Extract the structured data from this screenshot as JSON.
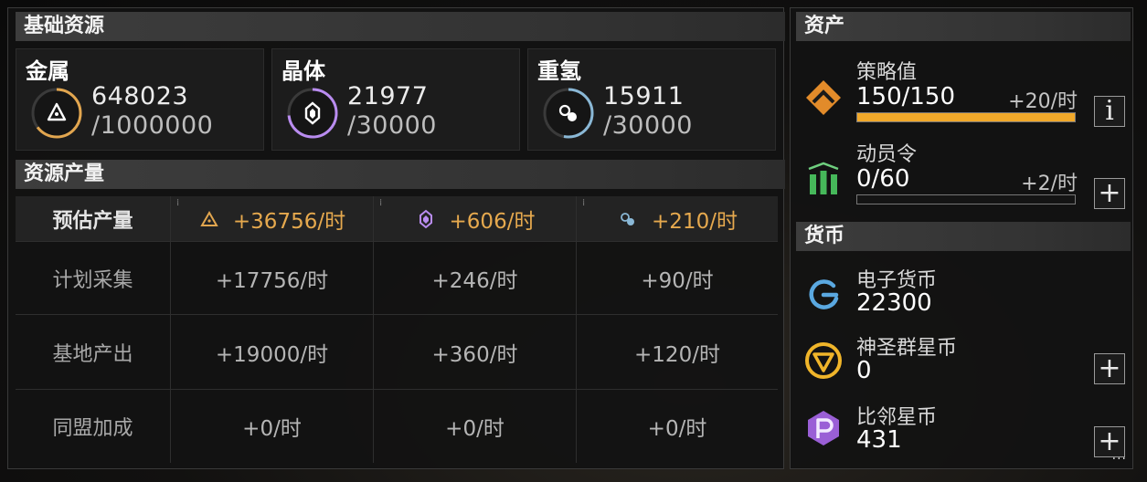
{
  "basic_resources": {
    "title": "基础资源",
    "items": [
      {
        "name": "金属",
        "current": "648023",
        "max": "/1000000",
        "ring_color": "#e2a64f",
        "fill": 0.648,
        "icon": "metal-triangle-icon"
      },
      {
        "name": "晶体",
        "current": "21977",
        "max": "/30000",
        "ring_color": "#b98cf0",
        "fill": 0.733,
        "icon": "crystal-hexagon-icon"
      },
      {
        "name": "重氢",
        "current": "15911",
        "max": "/30000",
        "ring_color": "#8ab8d6",
        "fill": 0.53,
        "icon": "deuterium-dots-icon"
      }
    ]
  },
  "production": {
    "title": "资源产量",
    "rows": [
      {
        "label": "预估产量",
        "metal": "+36756/时",
        "crystal": "+606/时",
        "deuterium": "+210/时"
      },
      {
        "label": "计划采集",
        "metal": "+17756/时",
        "crystal": "+246/时",
        "deuterium": "+90/时"
      },
      {
        "label": "基地产出",
        "metal": "+19000/时",
        "crystal": "+360/时",
        "deuterium": "+120/时"
      },
      {
        "label": "同盟加成",
        "metal": "+0/时",
        "crystal": "+0/时",
        "deuterium": "+0/时"
      }
    ]
  },
  "assets": {
    "title": "资产",
    "strategy": {
      "name": "策略值",
      "value": "150/150",
      "rate": "+20/时",
      "fill": 1.0,
      "info_label": "i",
      "icon": "strategy-chevron-icon"
    },
    "mobilize": {
      "name": "动员令",
      "value": "0/60",
      "rate": "+2/时",
      "fill": 0.0,
      "add_label": "+",
      "icon": "mobilize-bars-icon"
    }
  },
  "currency": {
    "title": "货币",
    "items": [
      {
        "name": "电子货币",
        "value": "22300",
        "icon": "e-currency-icon"
      },
      {
        "name": "神圣群星币",
        "value": "0",
        "add_label": "+",
        "icon": "holy-star-coin-icon"
      },
      {
        "name": "比邻星币",
        "value": "431",
        "add_label": "+",
        "icon": "proxima-coin-icon"
      }
    ],
    "more": "···"
  },
  "colors": {
    "accent_gold": "#e6a94e",
    "bar_fill": "#f0a82a",
    "metal": "#e2a64f",
    "crystal": "#b98cf0",
    "deuterium": "#8ab8d6"
  }
}
